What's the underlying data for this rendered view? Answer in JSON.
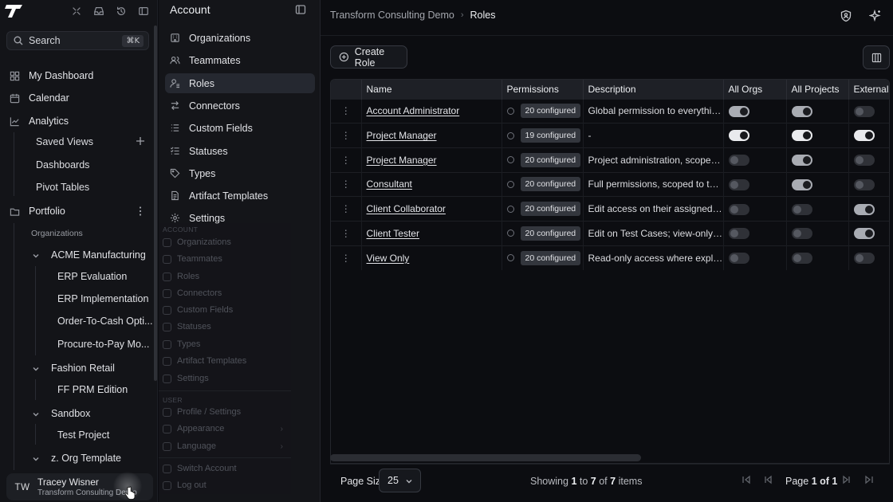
{
  "colors": {
    "background": "#0b0c10",
    "panel": "#141519",
    "active_item": "#252830",
    "toggle_on": "#e9eaed"
  },
  "topbar_icons": [
    "logo-icon",
    "collapse-icon",
    "inbox-icon",
    "history-icon",
    "sidebar-toggle-icon"
  ],
  "search": {
    "placeholder": "Search",
    "shortcut": "⌘K"
  },
  "nav": {
    "dashboard": "My Dashboard",
    "calendar": "Calendar",
    "analytics": "Analytics",
    "saved_views": "Saved Views",
    "dashboards": "Dashboards",
    "pivot_tables": "Pivot Tables",
    "portfolio": "Portfolio",
    "organizations_label": "Organizations",
    "orgs": [
      {
        "name": "ACME Manufacturing",
        "projects": [
          "ERP Evaluation",
          "ERP Implementation",
          "Order-To-Cash Opti...",
          "Procure-to-Pay Mo..."
        ]
      },
      {
        "name": "Fashion Retail",
        "projects": [
          "FF PRM Edition"
        ]
      },
      {
        "name": "Sandbox",
        "projects": [
          "Test Project"
        ]
      },
      {
        "name": "z. Org Template",
        "projects": []
      }
    ]
  },
  "user": {
    "initials": "TW",
    "name": "Tracey Wisner",
    "org": "Transform Consulting Demo"
  },
  "account_panel": {
    "title": "Account",
    "items": [
      "Organizations",
      "Teammates",
      "Roles",
      "Connectors",
      "Custom Fields",
      "Statuses",
      "Types",
      "Artifact Templates",
      "Settings"
    ],
    "active": "Roles"
  },
  "ghost_menu": {
    "account_label": "ACCOUNT",
    "account_items": [
      "Organizations",
      "Teammates",
      "Roles",
      "Connectors",
      "Custom Fields",
      "Statuses",
      "Types",
      "Artifact Templates",
      "Settings"
    ],
    "user_label": "USER",
    "user_items": [
      "Profile / Settings",
      "Appearance",
      "Language"
    ],
    "session_items": [
      "Switch Account",
      "Log out"
    ]
  },
  "breadcrumb": {
    "org": "Transform Consulting Demo",
    "page": "Roles"
  },
  "toolbar": {
    "create_label": "Create Role"
  },
  "table": {
    "columns": [
      "Name",
      "Permissions",
      "Description",
      "All Orgs",
      "All Projects",
      "External"
    ],
    "rows": [
      {
        "name": "Account Administrator",
        "perms": "20 configured",
        "desc": "Global permission to everything...",
        "all_orgs": "on",
        "all_projects": "on",
        "external": "off"
      },
      {
        "name": "Project Manager",
        "perms": "19 configured",
        "desc": "-",
        "all_orgs": "onbright",
        "all_projects": "onbright",
        "external": "onbright"
      },
      {
        "name": "Project Manager",
        "perms": "20 configured",
        "desc": "Project administration, scoped t...",
        "all_orgs": "off",
        "all_projects": "on",
        "external": "off"
      },
      {
        "name": "Consultant",
        "perms": "20 configured",
        "desc": "Full permissions, scoped to their...",
        "all_orgs": "off",
        "all_projects": "on",
        "external": "off"
      },
      {
        "name": "Client Collaborator",
        "perms": "20 configured",
        "desc": "Edit access on their assigned Or...",
        "all_orgs": "off",
        "all_projects": "off",
        "external": "on"
      },
      {
        "name": "Client Tester",
        "perms": "20 configured",
        "desc": "Edit on Test Cases; view-only on...",
        "all_orgs": "off",
        "all_projects": "off",
        "external": "on"
      },
      {
        "name": "View Only",
        "perms": "20 configured",
        "desc": "Read-only access where explicitl...",
        "all_orgs": "off",
        "all_projects": "off",
        "external": "off"
      }
    ]
  },
  "footer": {
    "page_size_label": "Page Size",
    "page_size": "25",
    "showing_prefix": "Showing",
    "from": "1",
    "to_word": "to",
    "to": "7",
    "of_word": "of",
    "total": "7",
    "items_word": "items",
    "page_word": "Page",
    "page": "1",
    "page_of": "of",
    "pages": "1"
  }
}
